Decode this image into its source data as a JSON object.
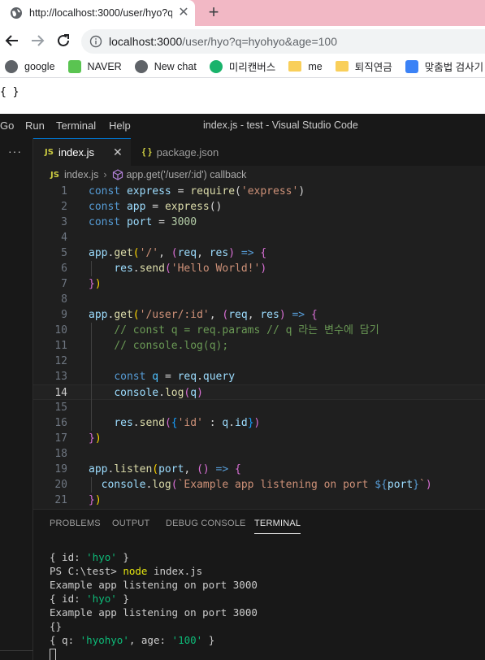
{
  "browser": {
    "tab_title": "http://localhost:3000/user/hyo?q",
    "url_host": "localhost:3000",
    "url_path": "/user/hyo?q=hyohyo&age=100",
    "bookmarks": [
      {
        "label": "google",
        "icon": "chrome-icon",
        "color": "#5f6368"
      },
      {
        "label": "NAVER",
        "icon": "naver-icon",
        "color": "#5ac451"
      },
      {
        "label": "New chat",
        "icon": "openai-icon",
        "color": "#5f6368"
      },
      {
        "label": "미리캔버스",
        "icon": "miri-icon",
        "color": "#19b36b"
      },
      {
        "label": "me",
        "icon": "folder-icon",
        "color": "#f9cf5a"
      },
      {
        "label": "퇴직연금",
        "icon": "folder-icon",
        "color": "#f9cf5a"
      },
      {
        "label": "맞춤법 검사기",
        "icon": "speller-icon",
        "color": "#3b82f6"
      }
    ],
    "page_text": "{ }"
  },
  "vscode": {
    "menu": [
      "Go",
      "Run",
      "Terminal",
      "Help"
    ],
    "window_title": "index.js - test - Visual Studio Code",
    "sidebar_more": "···",
    "tabs": [
      {
        "label": "index.js",
        "icon": "JS"
      },
      {
        "label": "package.json",
        "icon": "{ }"
      }
    ],
    "close_glyph": "✕",
    "breadcrumb": {
      "file": "index.js",
      "symbol": "app.get('/user/:id') callback"
    },
    "line_numbers": [
      "1",
      "2",
      "3",
      "4",
      "5",
      "6",
      "7",
      "8",
      "9",
      "10",
      "11",
      "12",
      "13",
      "14",
      "15",
      "16",
      "17",
      "18",
      "19",
      "20",
      "21"
    ],
    "current_line": 14,
    "code": {
      "l1": [
        "const",
        "express",
        "=",
        "require",
        "(",
        "'express'",
        ")"
      ],
      "l2": [
        "const",
        "app",
        "=",
        "express",
        "()"
      ],
      "l3": [
        "const",
        "port",
        "=",
        "3000"
      ],
      "l5": [
        "app",
        ".",
        "get",
        "(",
        "'/'",
        ", ",
        "(",
        "req",
        ", ",
        "res",
        ")",
        " => ",
        "{"
      ],
      "l6": [
        "res",
        ".",
        "send",
        "(",
        "'Hello World!'",
        ")"
      ],
      "l7": [
        "}",
        ")"
      ],
      "l9": [
        "app",
        ".",
        "get",
        "(",
        "'/user/:id'",
        ", ",
        "(",
        "req",
        ", ",
        "res",
        ")",
        " => ",
        "{"
      ],
      "l10": "// const q = req.params // q 라는 변수에 담기",
      "l11": "// console.log(q);",
      "l13": [
        "const",
        "q",
        "=",
        "req",
        ".",
        "query"
      ],
      "l14": [
        "console",
        ".",
        "log",
        "(",
        "q",
        ")"
      ],
      "l16": [
        "res",
        ".",
        "send",
        "(",
        "{",
        "'id'",
        " : ",
        "q",
        ".",
        "id",
        "}",
        ")"
      ],
      "l17": [
        "}",
        ")"
      ],
      "l19": [
        "app",
        ".",
        "listen",
        "(",
        "port",
        ", ",
        "()",
        " => ",
        "{"
      ],
      "l20": [
        "console",
        ".",
        "log",
        "(",
        "`Example app listening on port ",
        "${",
        "port",
        "}",
        "`",
        ")"
      ],
      "l21": [
        "}",
        ")"
      ]
    },
    "panel_tabs": [
      "PROBLEMS",
      "OUTPUT",
      "DEBUG CONSOLE",
      "TERMINAL"
    ],
    "terminal": {
      "line1": [
        "{ id: ",
        "'hyo'",
        " }"
      ],
      "line2": [
        "PS C:\\test> ",
        "node",
        " index.js"
      ],
      "line3": "Example app listening on port 3000",
      "line4": [
        "{ id: ",
        "'hyo'",
        " }"
      ],
      "line5": "Example app listening on port 3000",
      "line6": "{}",
      "line7": [
        "{ q: ",
        "'hyohyo'",
        ", age: ",
        "'100'",
        " }"
      ]
    }
  }
}
